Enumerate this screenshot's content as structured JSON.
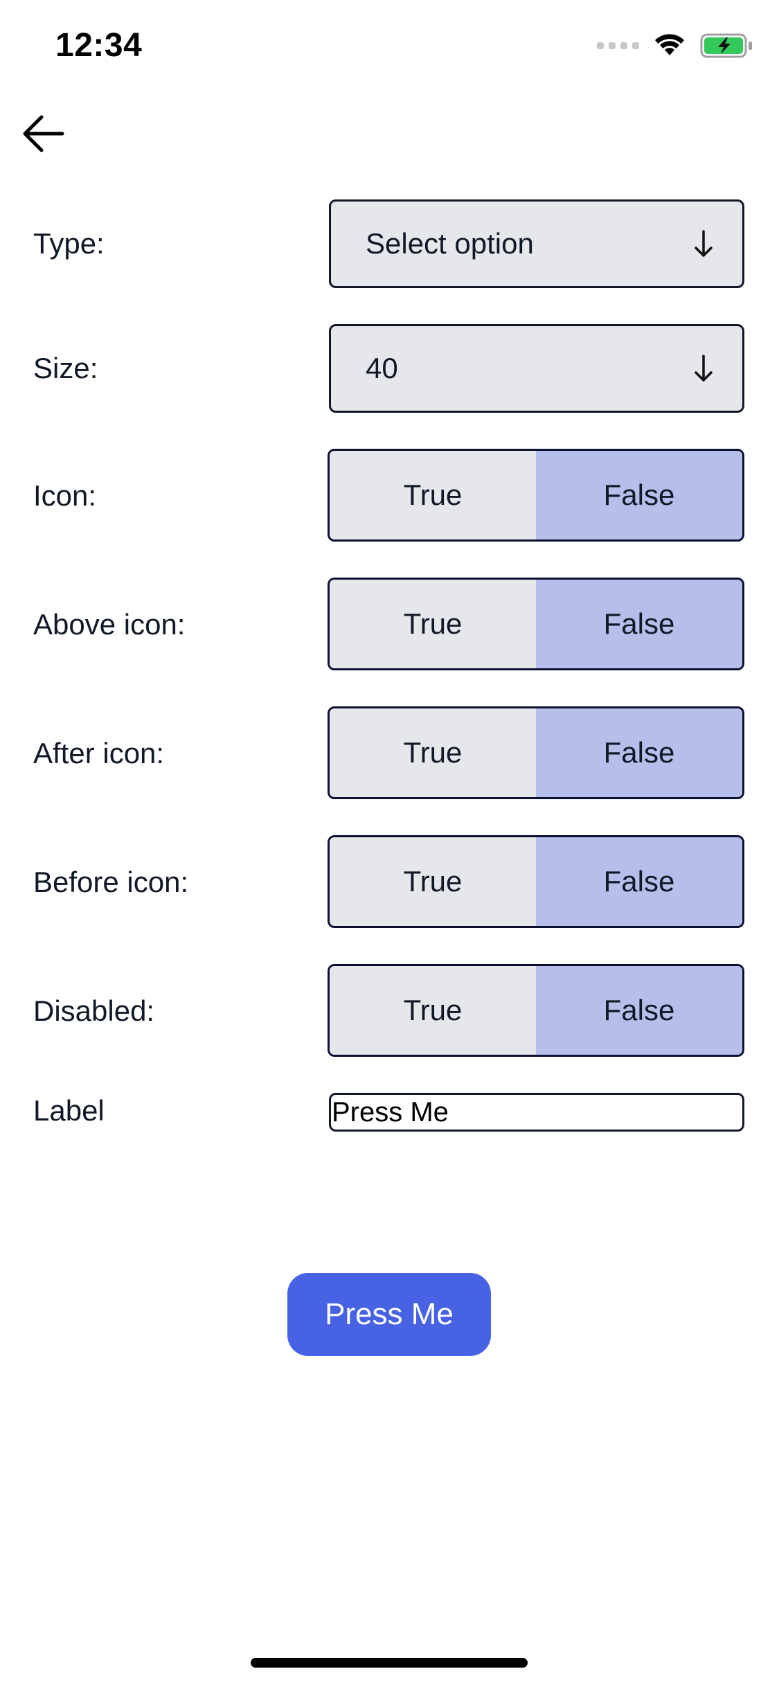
{
  "status_bar": {
    "time": "12:34"
  },
  "icons": {
    "back": "arrow-left-icon",
    "select_arrow": "arrow-down-icon",
    "wifi": "wifi-icon",
    "battery": "battery-charging-icon",
    "signal": "cellular-signal-icon"
  },
  "form": {
    "type": {
      "label": "Type:",
      "value": "Select option"
    },
    "size": {
      "label": "Size:",
      "value": "40"
    },
    "icon": {
      "label": "Icon:",
      "true_label": "True",
      "false_label": "False",
      "selected": "False"
    },
    "above_icon": {
      "label": "Above icon:",
      "true_label": "True",
      "false_label": "False",
      "selected": "False"
    },
    "after_icon": {
      "label": "After icon:",
      "true_label": "True",
      "false_label": "False",
      "selected": "False"
    },
    "before_icon": {
      "label": "Before icon:",
      "true_label": "True",
      "false_label": "False",
      "selected": "False"
    },
    "disabled": {
      "label": "Disabled:",
      "true_label": "True",
      "false_label": "False",
      "selected": "False"
    },
    "label_field": {
      "label": "Label",
      "value": "Press Me"
    }
  },
  "preview_button": {
    "label": "Press Me"
  },
  "colors": {
    "primary": "#4763e4",
    "toggle_selected": "#b6bfe9",
    "control_bg": "#e5e7eb",
    "battery_fill": "#34c759"
  }
}
